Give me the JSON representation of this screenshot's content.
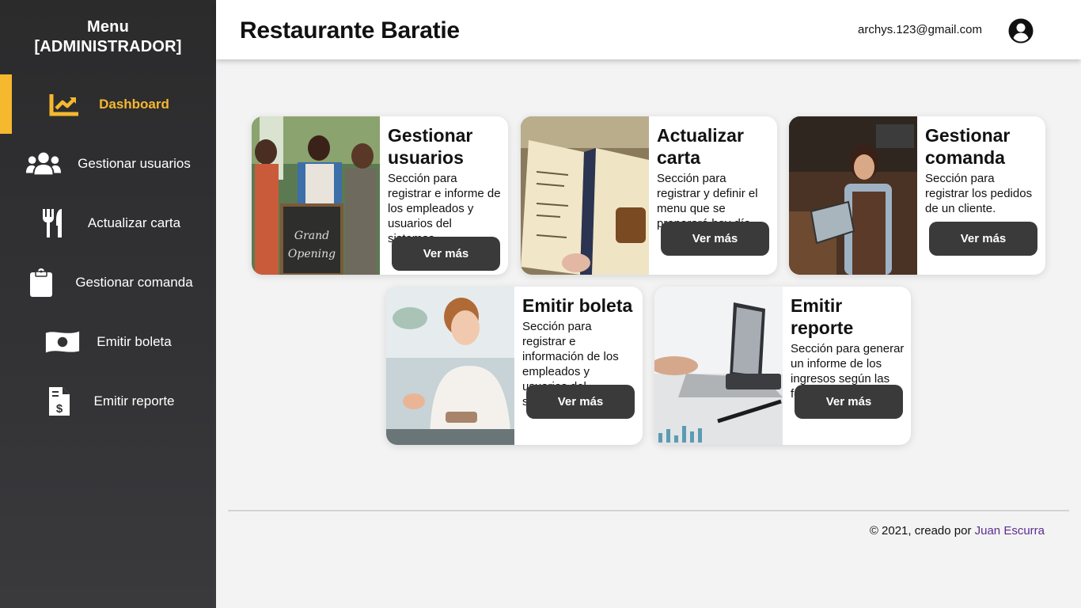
{
  "sidebar": {
    "title_line1": "Menu",
    "title_line2": "[ADMINISTRADOR]",
    "items": [
      {
        "label": "Dashboard",
        "icon": "chart-line-icon"
      },
      {
        "label": "Gestionar usuarios",
        "icon": "users-icon"
      },
      {
        "label": "Actualizar carta",
        "icon": "utensils-icon"
      },
      {
        "label": "Gestionar comanda",
        "icon": "clipboard-icon"
      },
      {
        "label": "Emitir boleta",
        "icon": "money-bill-icon"
      },
      {
        "label": "Emitir reporte",
        "icon": "invoice-dollar-icon"
      }
    ],
    "active_color": "#f5b82e"
  },
  "header": {
    "title": "Restaurante Baratie",
    "email": "archys.123@gmail.com",
    "avatar_icon": "user-circle-icon"
  },
  "cards": [
    {
      "title": "Gestionar usuarios",
      "desc": "Sección para registrar e informe de los empleados y usuarios del sistemas.",
      "button": "Ver más"
    },
    {
      "title": "Actualizar carta",
      "desc": "Sección para registrar y definir el menu que se preparará hoy día.",
      "button": "Ver más"
    },
    {
      "title": "Gestionar comanda",
      "desc": "Sección para registrar los pedidos de un cliente.",
      "button": "Ver más"
    },
    {
      "title": "Emitir boleta",
      "desc": "Sección para registrar e información de los empleados y usuarios del sistemas.",
      "button": "Ver más"
    },
    {
      "title": "Emitir reporte",
      "desc": "Sección para generar un informe de los ingresos según las fechas solicitadas.",
      "button": "Ver más"
    }
  ],
  "footer": {
    "text": "© 2021, creado por",
    "author": "Juan Escurra"
  }
}
